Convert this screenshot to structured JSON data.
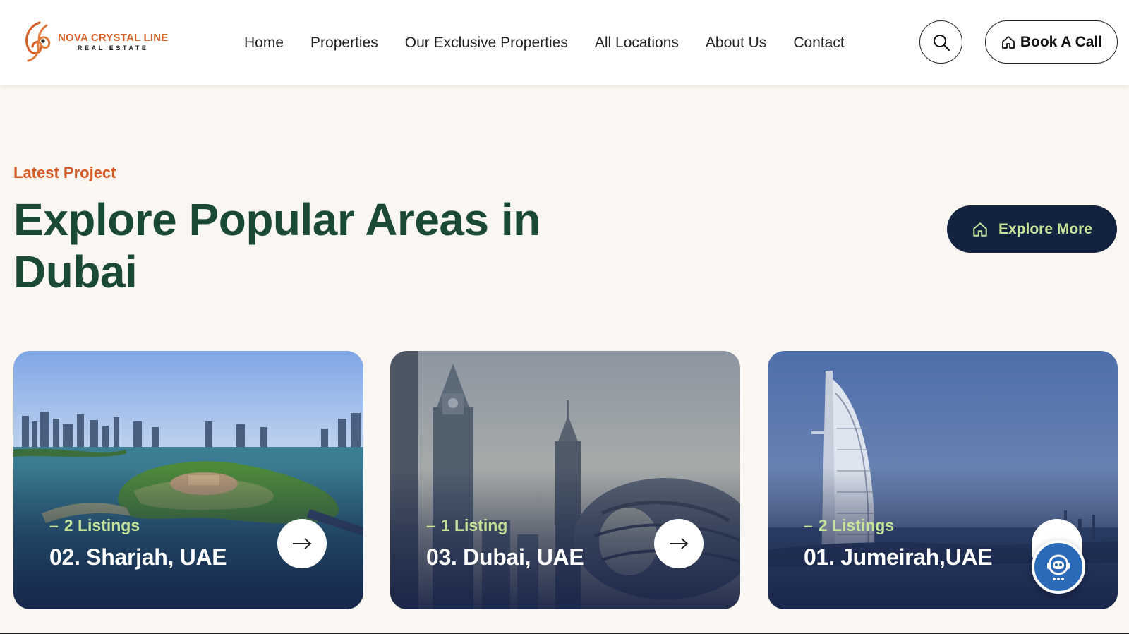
{
  "brand": {
    "name": "NOVA CRYSTAL LINE",
    "tagline": "REAL ESTATE",
    "accent_color": "#d6602a"
  },
  "nav": {
    "items": [
      "Home",
      "Properties",
      "Our Exclusive Properties",
      "All Locations",
      "About Us",
      "Contact"
    ]
  },
  "header_actions": {
    "search_icon": "search-icon",
    "book_call_label": "Book A Call",
    "book_call_icon": "home-icon"
  },
  "hero": {
    "eyebrow": "Latest Project",
    "title": "Explore Popular Areas in Dubai",
    "explore_label": "Explore More",
    "explore_icon": "home-icon",
    "title_color": "#1a4a33",
    "button_color": "#13233f",
    "highlight_color": "#c5e39a"
  },
  "cards": [
    {
      "count": "2 Listings",
      "name": "02. Sharjah, UAE",
      "image": "sharjah-waterfront-photo",
      "has_arrow": true
    },
    {
      "count": "1 Listing",
      "name": "03. Dubai, UAE",
      "image": "dubai-museum-of-future-photo",
      "has_arrow": true
    },
    {
      "count": "2 Listings",
      "name": "01. Jumeirah,UAE",
      "image": "burj-al-arab-photo",
      "has_arrow": false
    }
  ],
  "chat_widget": {
    "icon": "chatbot-icon"
  }
}
